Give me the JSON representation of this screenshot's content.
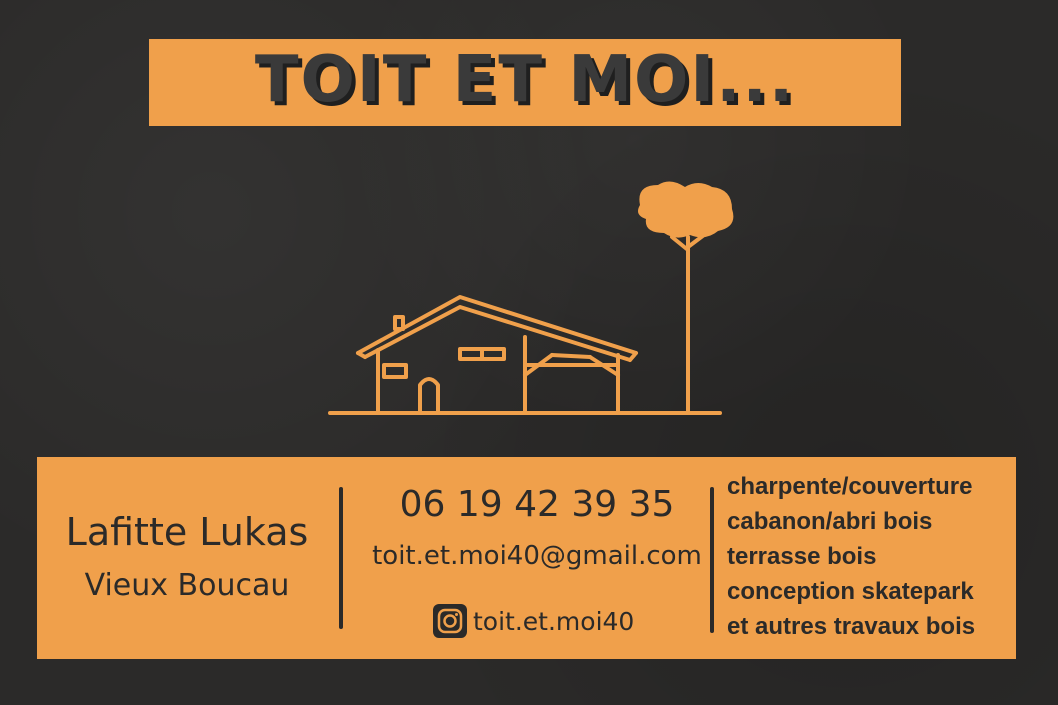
{
  "brand": {
    "title": "TOIT ET MOI..."
  },
  "colors": {
    "background": "#2b2a29",
    "accent": "#f0a04b",
    "text": "#2b2a29"
  },
  "illustration": {
    "house_icon": "house-outline-icon",
    "tree_icon": "pine-tree-icon"
  },
  "contact": {
    "name": "Lafitte Lukas",
    "city": "Vieux Boucau",
    "phone": "06 19 42 39 35",
    "email": "toit.et.moi40@gmail.com",
    "instagram_icon": "instagram-icon",
    "instagram": "toit.et.moi40"
  },
  "services": [
    "charpente/couverture",
    "cabanon/abri bois",
    "terrasse bois",
    "conception skatepark",
    "et autres travaux bois"
  ]
}
